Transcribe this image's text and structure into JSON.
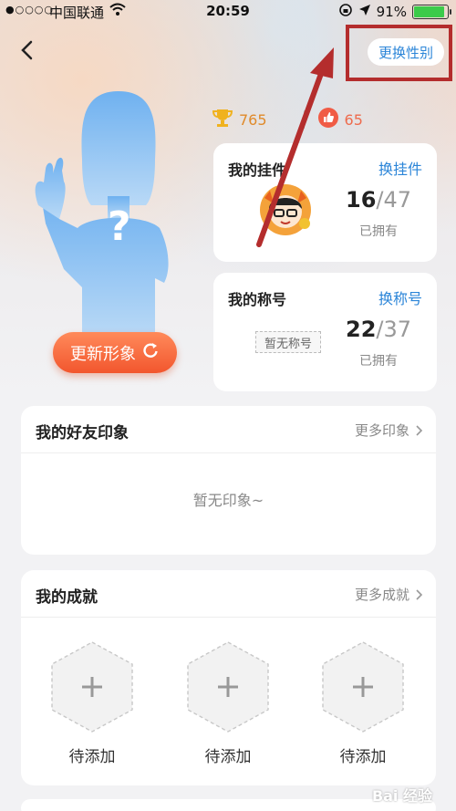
{
  "status_bar": {
    "signal": "●○○○○",
    "carrier": "中国联通",
    "time": "20:59",
    "battery": "91%",
    "battery_level": 0.91
  },
  "header": {
    "change_gender": "更换性别"
  },
  "avatar": {
    "question_mark": "?",
    "update_button": "更新形象"
  },
  "stats": {
    "trophies": "765",
    "likes": "65"
  },
  "pendant_card": {
    "title": "我的挂件",
    "link": "换挂件",
    "owned": "16",
    "total": "/47",
    "owned_label": "已拥有"
  },
  "title_card": {
    "title": "我的称号",
    "link": "换称号",
    "placeholder": "暂无称号",
    "owned": "22",
    "total": "/37",
    "owned_label": "已拥有"
  },
  "impressions": {
    "title": "我的好友印象",
    "more": "更多印象",
    "empty": "暂无印象~"
  },
  "achievements": {
    "title": "我的成就",
    "more": "更多成就",
    "slots": [
      "待添加",
      "待添加",
      "待添加"
    ]
  },
  "colors": {
    "accent_blue": "#2b85d8",
    "orange_button": "#f2562e",
    "annotation_red": "#b42d2d"
  },
  "watermark": "Bai 经验"
}
